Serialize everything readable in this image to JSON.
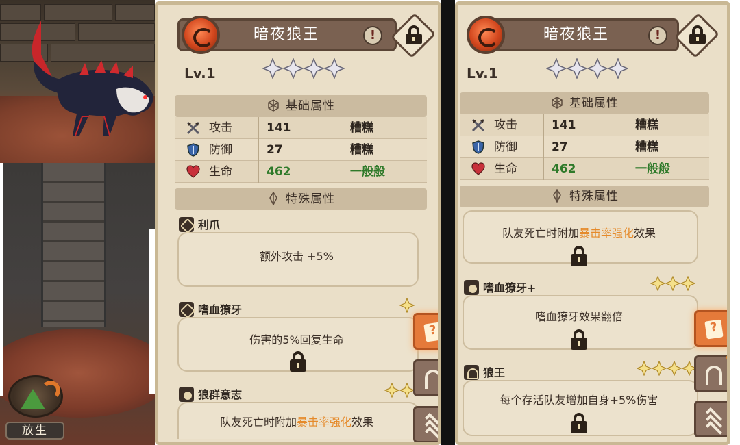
{
  "release": {
    "label": "放生"
  },
  "panels": [
    {
      "name": "暗夜狼王",
      "level": "Lv.1",
      "stars": 4,
      "info_symbol": "!",
      "base_header": "基础属性",
      "special_header": "特殊属性",
      "attributes": [
        {
          "icon": "swords-icon",
          "label": "攻击",
          "value": "141",
          "grade": "糟糕"
        },
        {
          "icon": "shield-icon",
          "label": "防御",
          "value": "27",
          "grade": "糟糕"
        },
        {
          "icon": "heart-icon",
          "label": "生命",
          "value": "462",
          "grade": "一般般"
        }
      ],
      "skills": [
        {
          "title": "利爪",
          "desc": "额外攻击 +5%",
          "desc_hl": "",
          "desc_tail": "",
          "stars": 0,
          "locked": false
        },
        {
          "title": "嗜血獠牙",
          "desc": "伤害的5%回复生命",
          "desc_hl": "",
          "desc_tail": "",
          "stars": 1,
          "locked": true
        },
        {
          "title": "狼群意志",
          "desc": "队友死亡时附加",
          "desc_hl": "暴击率强化",
          "desc_tail": "效果",
          "stars": 2,
          "locked": true
        }
      ]
    },
    {
      "name": "暗夜狼王",
      "level": "Lv.1",
      "stars": 4,
      "info_symbol": "!",
      "base_header": "基础属性",
      "special_header": "特殊属性",
      "attributes": [
        {
          "icon": "swords-icon",
          "label": "攻击",
          "value": "141",
          "grade": "糟糕"
        },
        {
          "icon": "shield-icon",
          "label": "防御",
          "value": "27",
          "grade": "糟糕"
        },
        {
          "icon": "heart-icon",
          "label": "生命",
          "value": "462",
          "grade": "一般般"
        }
      ],
      "skills": [
        {
          "title": "",
          "desc": "队友死亡时附加",
          "desc_hl": "暴击率强化",
          "desc_tail": "效果",
          "stars": 0,
          "locked": true
        },
        {
          "title": "嗜血獠牙+",
          "desc": "嗜血獠牙效果翻倍",
          "desc_hl": "",
          "desc_tail": "",
          "stars": 3,
          "locked": true
        },
        {
          "title": "狼王",
          "desc": "每个存活队友增加自身+5%伤害",
          "desc_hl": "",
          "desc_tail": "",
          "stars": 4,
          "locked": true
        }
      ]
    }
  ],
  "side_buttons": [
    {
      "name": "help-book-button",
      "icon": "question-book-icon"
    },
    {
      "name": "upgrade-button",
      "icon": "arch-icon"
    },
    {
      "name": "rank-button",
      "icon": "chevrons-up-icon"
    }
  ],
  "colors": {
    "highlight": "#e58a2a",
    "good": "#2f7a2a",
    "panel": "#eadfc8"
  }
}
